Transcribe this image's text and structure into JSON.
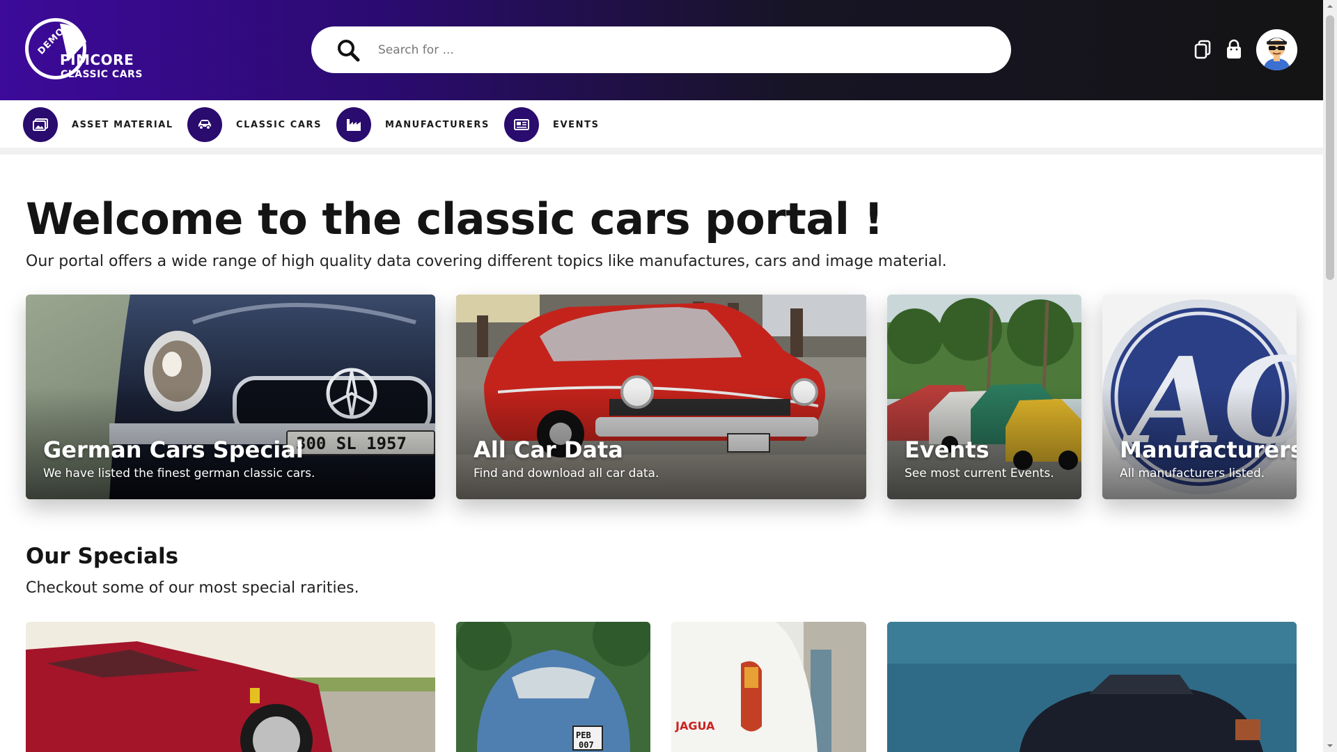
{
  "header": {
    "logo": {
      "badge": "DEMO",
      "name": "PIMCORE",
      "subtitle": "CLASSIC CARS"
    },
    "search": {
      "placeholder": "Search for ...",
      "value": ""
    },
    "icons": [
      "copy-icon",
      "shopping-bag-icon",
      "user-avatar"
    ]
  },
  "nav": {
    "items": [
      {
        "label": "ASSET MATERIAL",
        "icon": "image-icon"
      },
      {
        "label": "CLASSIC CARS",
        "icon": "car-icon"
      },
      {
        "label": "MANUFACTURERS",
        "icon": "factory-icon"
      },
      {
        "label": "EVENTS",
        "icon": "newspaper-icon"
      }
    ]
  },
  "hero": {
    "title": "Welcome to the classic cars portal !",
    "subtitle": "Our portal offers a wide range of high quality data covering different topics like manufactures, cars and image material."
  },
  "cards": [
    {
      "title": "German Cars Special",
      "description": "We have listed the finest german classic cars."
    },
    {
      "title": "All Car Data",
      "description": "Find and download all car data."
    },
    {
      "title": "Events",
      "description": "See most current Events."
    },
    {
      "title": "Manufacturers",
      "description": "All manufacturers listed."
    }
  ],
  "specials": {
    "title": "Our Specials",
    "subtitle": "Checkout some of our most special rarities."
  },
  "colors": {
    "brand_purple": "#2a0b6e",
    "header_gradient_start": "#3d0a9a",
    "header_dark": "#141414"
  }
}
